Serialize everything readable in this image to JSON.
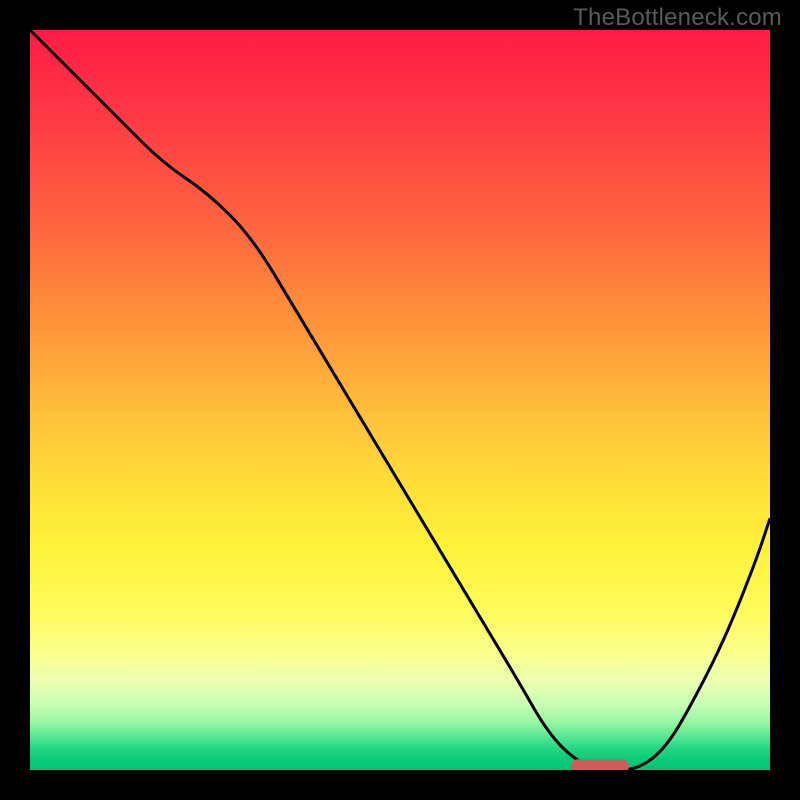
{
  "watermark": "TheBottleneck.com",
  "chart_data": {
    "type": "line",
    "title": "",
    "xlabel": "",
    "ylabel": "",
    "xlim": [
      0,
      100
    ],
    "ylim": [
      0,
      100
    ],
    "series": [
      {
        "name": "curve",
        "x": [
          0,
          6,
          12,
          18,
          24,
          30,
          36,
          42,
          48,
          54,
          60,
          66,
          70,
          74,
          78,
          82,
          86,
          90,
          94,
          98,
          100
        ],
        "y": [
          100,
          94,
          88,
          82,
          78,
          72,
          62,
          52,
          42,
          32,
          22,
          12,
          5,
          1,
          0,
          0,
          3,
          10,
          18,
          28,
          34
        ]
      }
    ],
    "annotations": [
      {
        "name": "min-marker",
        "x_start": 74,
        "x_end": 80,
        "y": 0.5,
        "color": "#cd5c5c"
      }
    ],
    "background_gradient": {
      "direction": "top-to-bottom",
      "stops": [
        {
          "pos": 0.0,
          "color": "#ff1b44"
        },
        {
          "pos": 0.4,
          "color": "#ff953a"
        },
        {
          "pos": 0.7,
          "color": "#fff23a"
        },
        {
          "pos": 0.9,
          "color": "#c8ffb4"
        },
        {
          "pos": 1.0,
          "color": "#05c374"
        }
      ]
    }
  }
}
